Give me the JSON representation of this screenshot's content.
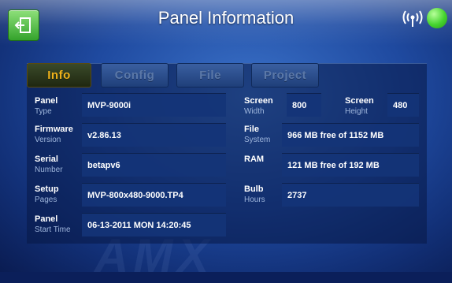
{
  "header": {
    "title": "Panel Information"
  },
  "tabs": [
    {
      "label": "Info",
      "active": true
    },
    {
      "label": "Config",
      "active": false
    },
    {
      "label": "File",
      "active": false
    },
    {
      "label": "Project",
      "active": false
    }
  ],
  "fields": {
    "panel_type": {
      "label": "Panel",
      "sub": "Type",
      "value": "MVP-9000i"
    },
    "firmware_version": {
      "label": "Firmware",
      "sub": "Version",
      "value": "v2.86.13"
    },
    "serial_number": {
      "label": "Serial",
      "sub": "Number",
      "value": "betapv6"
    },
    "setup_pages": {
      "label": "Setup",
      "sub": "Pages",
      "value": "MVP-800x480-9000.TP4"
    },
    "panel_start_time": {
      "label": "Panel",
      "sub": "Start Time",
      "value": "06-13-2011 MON 14:20:45"
    },
    "screen_width": {
      "label": "Screen",
      "sub": "Width",
      "value": "800"
    },
    "screen_height": {
      "label": "Screen",
      "sub": "Height",
      "value": "480"
    },
    "file_system": {
      "label": "File",
      "sub": "System",
      "value": "966 MB free of 1152 MB"
    },
    "ram": {
      "label": "RAM",
      "sub": "",
      "value": "121 MB free of 192 MB"
    },
    "bulb_hours": {
      "label": "Bulb",
      "sub": "Hours",
      "value": "2737"
    }
  },
  "icons": {
    "exit": "exit-icon",
    "signal": "wireless-signal-icon",
    "status": "status-indicator"
  },
  "colors": {
    "active_tab_text": "#f0b21a",
    "status_green": "#45d42e",
    "background": "#1f4aa0"
  }
}
